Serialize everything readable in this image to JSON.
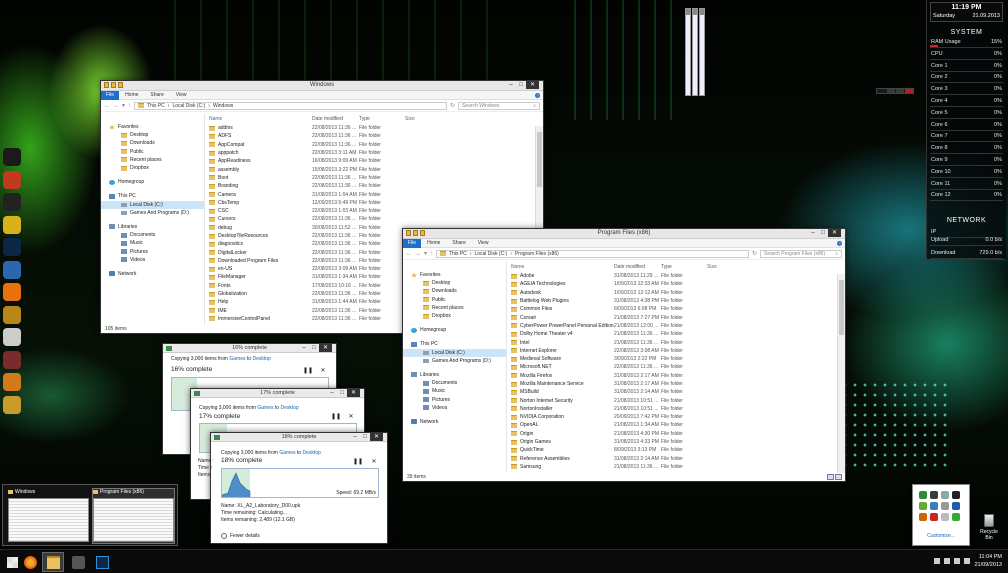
{
  "explorer1": {
    "title": "Windows",
    "ribbon": [
      "File",
      "Home",
      "Share",
      "View"
    ],
    "path": [
      "This PC",
      "Local Disk (C:)",
      "Windows"
    ],
    "search": "Search Windows",
    "columns": [
      "Name",
      "Date modified",
      "Type",
      "Size"
    ],
    "nav": [
      {
        "l": "Favorites",
        "k": "grp",
        "i": "star"
      },
      {
        "l": "Desktop",
        "k": "sub",
        "i": "fld"
      },
      {
        "l": "Downloads",
        "k": "sub",
        "i": "fld"
      },
      {
        "l": "Public",
        "k": "sub",
        "i": "fld"
      },
      {
        "l": "Recent places",
        "k": "sub",
        "i": "fld"
      },
      {
        "l": "Dropbox",
        "k": "sub",
        "i": "fld"
      },
      {
        "l": "Homegroup",
        "k": "grp",
        "i": "hg"
      },
      {
        "l": "This PC",
        "k": "grp",
        "i": "pc"
      },
      {
        "l": "Local Disk (C:)",
        "k": "sub sel",
        "i": "drv"
      },
      {
        "l": "Games And Programs (D:)",
        "k": "sub",
        "i": "drv"
      },
      {
        "l": "Libraries",
        "k": "grp",
        "i": "lib"
      },
      {
        "l": "Documents",
        "k": "sub",
        "i": "lib"
      },
      {
        "l": "Music",
        "k": "sub",
        "i": "lib"
      },
      {
        "l": "Pictures",
        "k": "sub",
        "i": "lib"
      },
      {
        "l": "Videos",
        "k": "sub",
        "i": "lib"
      },
      {
        "l": "Network",
        "k": "grp",
        "i": "net"
      }
    ],
    "rows": [
      [
        "addins",
        "22/08/2013 11:36 ...",
        "File folder"
      ],
      [
        "ADFS",
        "22/08/2013 11:36 ...",
        "File folder"
      ],
      [
        "AppCompat",
        "22/08/2013 11:36 ...",
        "File folder"
      ],
      [
        "apppatch",
        "22/08/2013 3:11 AM",
        "File folder"
      ],
      [
        "AppReadiness",
        "16/08/2013 9:09 AM",
        "File folder"
      ],
      [
        "assembly",
        "15/08/2013 3:22 PM",
        "File folder"
      ],
      [
        "Boot",
        "22/08/2013 11:36 ...",
        "File folder"
      ],
      [
        "Branding",
        "22/08/2013 11:36 ...",
        "File folder"
      ],
      [
        "Camera",
        "31/08/2013 1:04 AM",
        "File folder"
      ],
      [
        "CbsTemp",
        "12/09/2013 5:49 PM",
        "File folder"
      ],
      [
        "CSC",
        "22/08/2013 1:03 AM",
        "File folder"
      ],
      [
        "Cursors",
        "22/08/2013 11:36 ...",
        "File folder"
      ],
      [
        "debug",
        "30/08/2013 11:52 ...",
        "File folder"
      ],
      [
        "DesktopTileResources",
        "22/08/2013 11:36 ...",
        "File folder"
      ],
      [
        "diagnostics",
        "22/08/2013 11:36 ...",
        "File folder"
      ],
      [
        "DigitalLocker",
        "22/08/2013 11:36 ...",
        "File folder"
      ],
      [
        "Downloaded Program Files",
        "22/08/2013 11:36 ...",
        "File folder"
      ],
      [
        "en-US",
        "22/08/2013 3:09 AM",
        "File folder"
      ],
      [
        "FileManager",
        "31/08/2013 1:34 AM",
        "File folder"
      ],
      [
        "Fonts",
        "17/08/2013 10:16 ...",
        "File folder"
      ],
      [
        "Globalization",
        "22/08/2013 11:36 ...",
        "File folder"
      ],
      [
        "Help",
        "31/08/2013 1:44 AM",
        "File folder"
      ],
      [
        "IME",
        "22/08/2013 11:36 ...",
        "File folder"
      ],
      [
        "ImmersiveControlPanel",
        "22/08/2013 11:36 ...",
        "File folder"
      ]
    ],
    "status": "105 items"
  },
  "explorer2": {
    "title": "Program Files (x86)",
    "ribbon": [
      "File",
      "Home",
      "Share",
      "View"
    ],
    "path": [
      "This PC",
      "Local Disk (C:)",
      "Program Files (x86)"
    ],
    "search": "Search Program Files (x86)",
    "columns": [
      "Name",
      "Date modified",
      "Type",
      "Size"
    ],
    "nav": [
      {
        "l": "Favorites",
        "k": "grp",
        "i": "star"
      },
      {
        "l": "Desktop",
        "k": "sub",
        "i": "fld"
      },
      {
        "l": "Downloads",
        "k": "sub",
        "i": "fld"
      },
      {
        "l": "Public",
        "k": "sub",
        "i": "fld"
      },
      {
        "l": "Recent places",
        "k": "sub",
        "i": "fld"
      },
      {
        "l": "Dropbox",
        "k": "sub",
        "i": "fld"
      },
      {
        "l": "Homegroup",
        "k": "grp",
        "i": "hg"
      },
      {
        "l": "This PC",
        "k": "grp",
        "i": "pc"
      },
      {
        "l": "Local Disk (C:)",
        "k": "sub sel",
        "i": "drv"
      },
      {
        "l": "Games And Programs (D:)",
        "k": "sub",
        "i": "drv"
      },
      {
        "l": "Libraries",
        "k": "grp",
        "i": "lib"
      },
      {
        "l": "Documents",
        "k": "sub",
        "i": "lib"
      },
      {
        "l": "Music",
        "k": "sub",
        "i": "lib"
      },
      {
        "l": "Pictures",
        "k": "sub",
        "i": "lib"
      },
      {
        "l": "Videos",
        "k": "sub",
        "i": "lib"
      },
      {
        "l": "Network",
        "k": "grp",
        "i": "net"
      }
    ],
    "rows": [
      [
        "Adobe",
        "31/08/2013 11:29 ...",
        "File folder"
      ],
      [
        "AGEIA Technologies",
        "1/09/2013 12:33 AM",
        "File folder"
      ],
      [
        "Autodesk",
        "1/09/2013 12:12 AM",
        "File folder"
      ],
      [
        "Battlelog Web Plugins",
        "31/08/2013 4:38 PM",
        "File folder"
      ],
      [
        "Common Files",
        "6/09/2013 6:08 PM",
        "File folder"
      ],
      [
        "Corsair",
        "21/08/2013 7:27 PM",
        "File folder"
      ],
      [
        "CyberPower PowerPanel Personal Edition",
        "21/08/2013 12:00 ...",
        "File folder"
      ],
      [
        "Dolby Home Theater v4",
        "21/08/2013 11:36 ...",
        "File folder"
      ],
      [
        "Intel",
        "21/08/2013 11:36 ...",
        "File folder"
      ],
      [
        "Internet Explorer",
        "22/08/2013 3:08 AM",
        "File folder"
      ],
      [
        "Medieval Software",
        "3/09/2013 2:22 PM",
        "File folder"
      ],
      [
        "Microsoft.NET",
        "22/08/2013 11:36 ...",
        "File folder"
      ],
      [
        "Mozilla Firefox",
        "31/08/2013 2:17 AM",
        "File folder"
      ],
      [
        "Mozilla Maintenance Service",
        "31/08/2013 2:17 AM",
        "File folder"
      ],
      [
        "MSBuild",
        "31/08/2013 2:14 AM",
        "File folder"
      ],
      [
        "Norton Internet Security",
        "21/08/2013 10:51 ...",
        "File folder"
      ],
      [
        "NortonInstaller",
        "21/08/2013 10:51 ...",
        "File folder"
      ],
      [
        "NVIDIA Corporation",
        "20/09/2013 7:42 PM",
        "File folder"
      ],
      [
        "OpenAL",
        "21/08/2013 1:34 AM",
        "File folder"
      ],
      [
        "Origin",
        "21/08/2013 4:30 PM",
        "File folder"
      ],
      [
        "Origin Games",
        "31/08/2013 4:33 PM",
        "File folder"
      ],
      [
        "QuickTime",
        "8/09/2013 3:13 PM",
        "File folder"
      ],
      [
        "Reference Assemblies",
        "31/08/2013 2:14 AM",
        "File folder"
      ],
      [
        "Samsung",
        "21/08/2013 11:36 ...",
        "File folder"
      ]
    ],
    "status": "39 items"
  },
  "copy1": {
    "title": "16% complete",
    "line": "Copying 3,000 items from",
    "from": "Games",
    "to": "Desktop",
    "big": "16% complete",
    "progress": 16
  },
  "copy2": {
    "title": "17% complete",
    "line": "Copying 3,000 items from",
    "from": "Games",
    "to": "Desktop",
    "big": "17% complete",
    "progress": 17,
    "name_stub": "Name:",
    "time_stub": "Time r",
    "items_stub": "Items"
  },
  "copy3": {
    "title": "18% complete",
    "line": "Copying 3,000 items from",
    "from": "Games",
    "to": "Desktop",
    "big": "18% complete",
    "progress": 18,
    "speed": "Speed: 69.2 MB/s",
    "name": "Name: XL_A2_Laboratory_D00.upk",
    "time": "Time remaining:  Calculating...",
    "items": "Items remaining:  2,489 (12.1 GB)",
    "fewer": "Fewer details"
  },
  "word_to": "to",
  "gadget": {
    "time": "11:19 PM",
    "day": "Saturday",
    "date": "21.09.2013",
    "system": "SYSTEM",
    "rows": [
      [
        "RAM Usage",
        "15%"
      ],
      [
        "CPU",
        "0%"
      ],
      [
        "Core 1",
        "0%"
      ],
      [
        "Core 2",
        "0%"
      ],
      [
        "Core 3",
        "0%"
      ],
      [
        "Core 4",
        "0%"
      ],
      [
        "Core 5",
        "0%"
      ],
      [
        "Core 6",
        "0%"
      ],
      [
        "Core 7",
        "0%"
      ],
      [
        "Core 8",
        "0%"
      ],
      [
        "Core 9",
        "0%"
      ],
      [
        "Core 10",
        "0%"
      ],
      [
        "Core 11",
        "0%"
      ],
      [
        "Core 12",
        "0%"
      ]
    ],
    "network": "NETWORK",
    "ip_label": "IP",
    "ip_value": "",
    "upload_label": "Upload",
    "upload_value": "0.0 b/s",
    "download_label": "Download",
    "download_value": "729.0 b/s"
  },
  "thumbs": [
    "Windows",
    "Program Files (x86)"
  ],
  "tray": {
    "customize": "Customize..."
  },
  "recycle": "Recycle Bin",
  "clock": {
    "time": "11:04 PM",
    "date": "21/09/2013"
  },
  "colors": {
    "accent": "#1f6fc8",
    "link": "#1764b5"
  }
}
